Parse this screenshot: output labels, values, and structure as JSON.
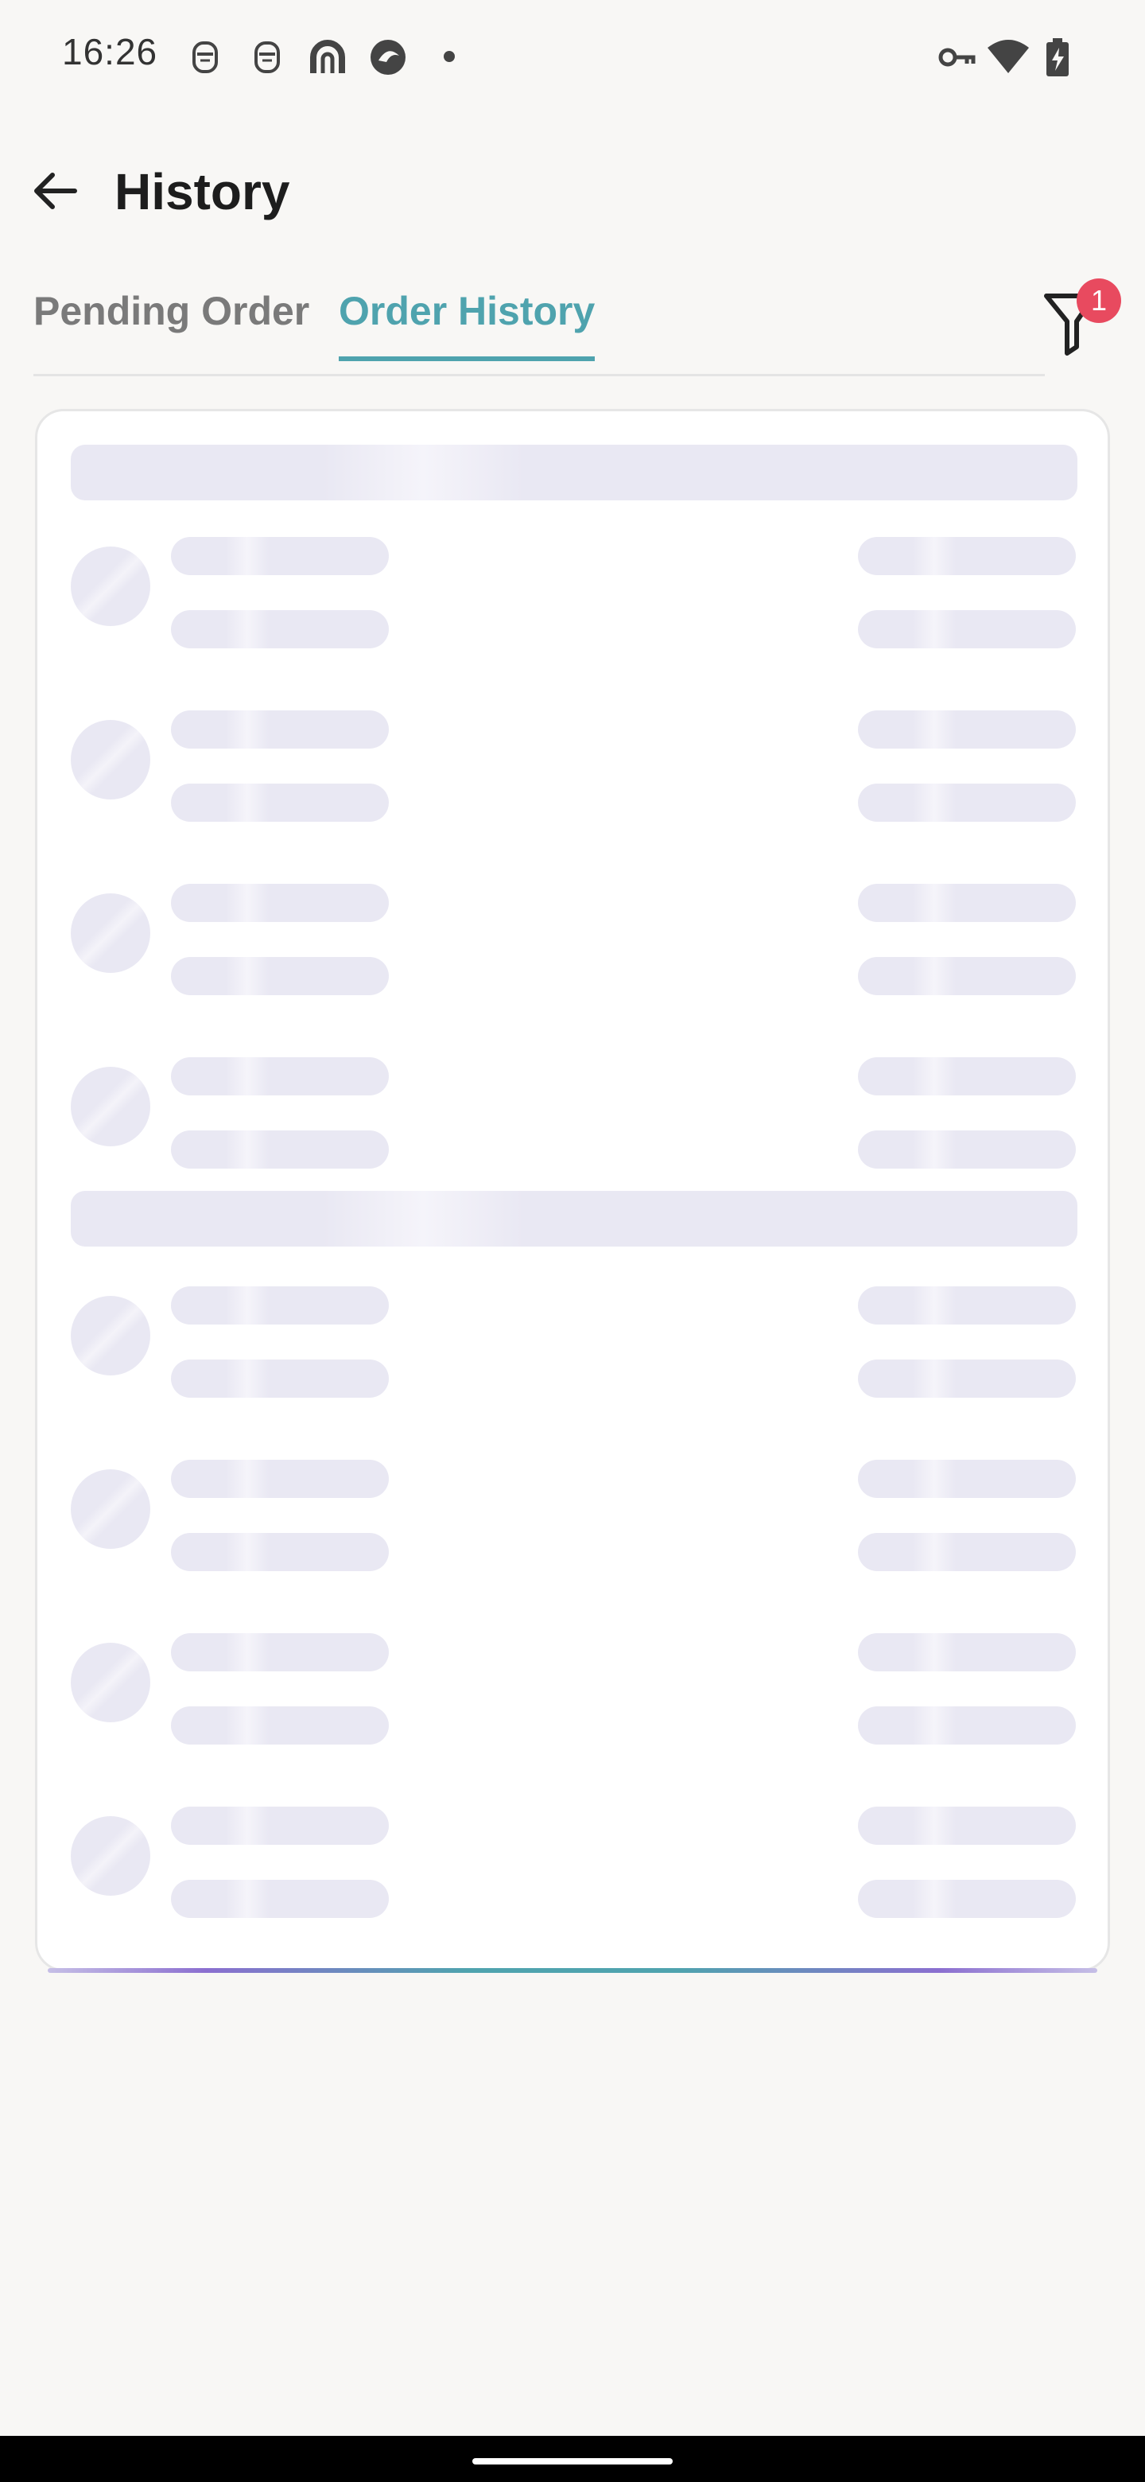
{
  "status_bar": {
    "time": "16:26",
    "left_icons": [
      "notification-face-icon",
      "notification-face-icon",
      "app-r-icon",
      "app-edge-icon",
      "more-dot-icon"
    ],
    "right_icons": [
      "vpn-key-icon",
      "wifi-icon",
      "battery-charging-icon"
    ]
  },
  "app_bar": {
    "back_icon": "arrow-left-icon",
    "title": "History"
  },
  "tabs": {
    "items": [
      {
        "label": "Pending Order",
        "selected": false
      },
      {
        "label": "Order History",
        "selected": true
      }
    ],
    "selected_color": "#4fa3ae"
  },
  "filter": {
    "icon": "filter-funnel-icon",
    "badge_count": "1",
    "badge_color": "#e84a5f"
  },
  "loading_placeholder": {
    "groups": [
      {
        "rows": 4
      },
      {
        "rows": 4
      }
    ],
    "skeleton_color": "#e9e8f3"
  }
}
